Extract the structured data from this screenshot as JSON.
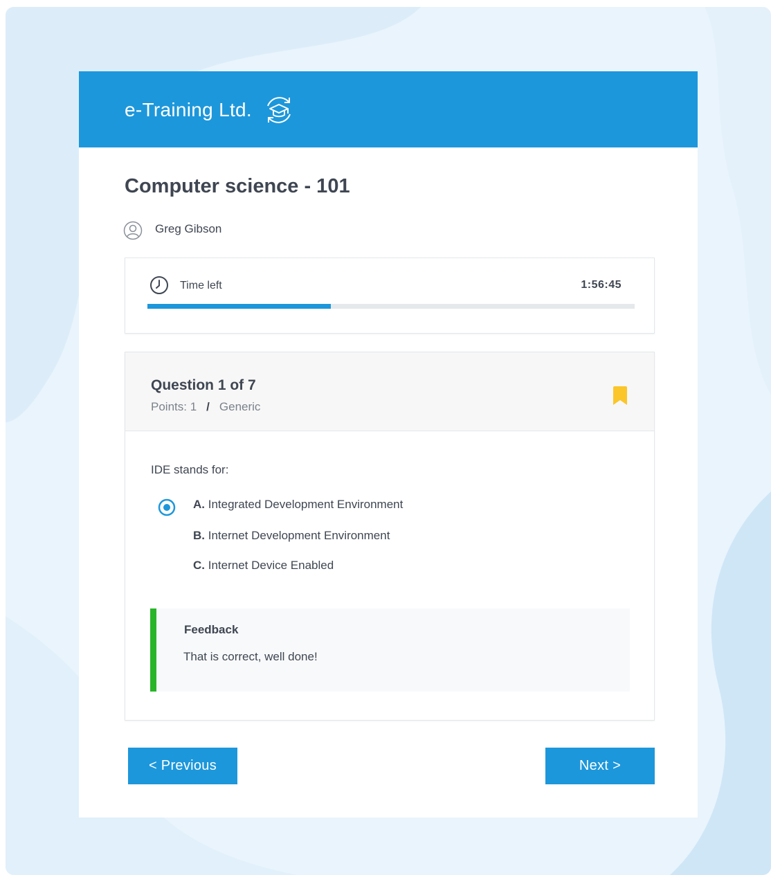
{
  "header": {
    "brand": "e-Training Ltd.",
    "brand_icon": "graduation-cap-refresh-icon"
  },
  "course": {
    "title": "Computer science - 101"
  },
  "user": {
    "name": "Greg Gibson",
    "icon": "user-icon"
  },
  "timer": {
    "label": "Time left",
    "value": "1:56:45",
    "progress_fraction": 0.376,
    "icon": "clock-icon"
  },
  "question": {
    "title": "Question 1 of 7",
    "points": "Points: 1",
    "separator": "/",
    "category": "Generic",
    "text": "IDE stands for:",
    "bookmark_icon": "bookmark-icon",
    "options": [
      {
        "letter": "A.",
        "text": "Integrated Development Environment",
        "selected": true
      },
      {
        "letter": "B.",
        "text": "Internet Development Environment",
        "selected": false
      },
      {
        "letter": "C.",
        "text": "Internet Device Enabled",
        "selected": false
      }
    ]
  },
  "feedback": {
    "title": "Feedback",
    "text": "That is correct, well done!"
  },
  "navigation": {
    "previous_label": "< Previous",
    "next_label": "Next >"
  },
  "colors": {
    "accent": "#1d97db",
    "bookmark": "#fbc62a",
    "success": "#28b528",
    "text": "#3f4652"
  }
}
